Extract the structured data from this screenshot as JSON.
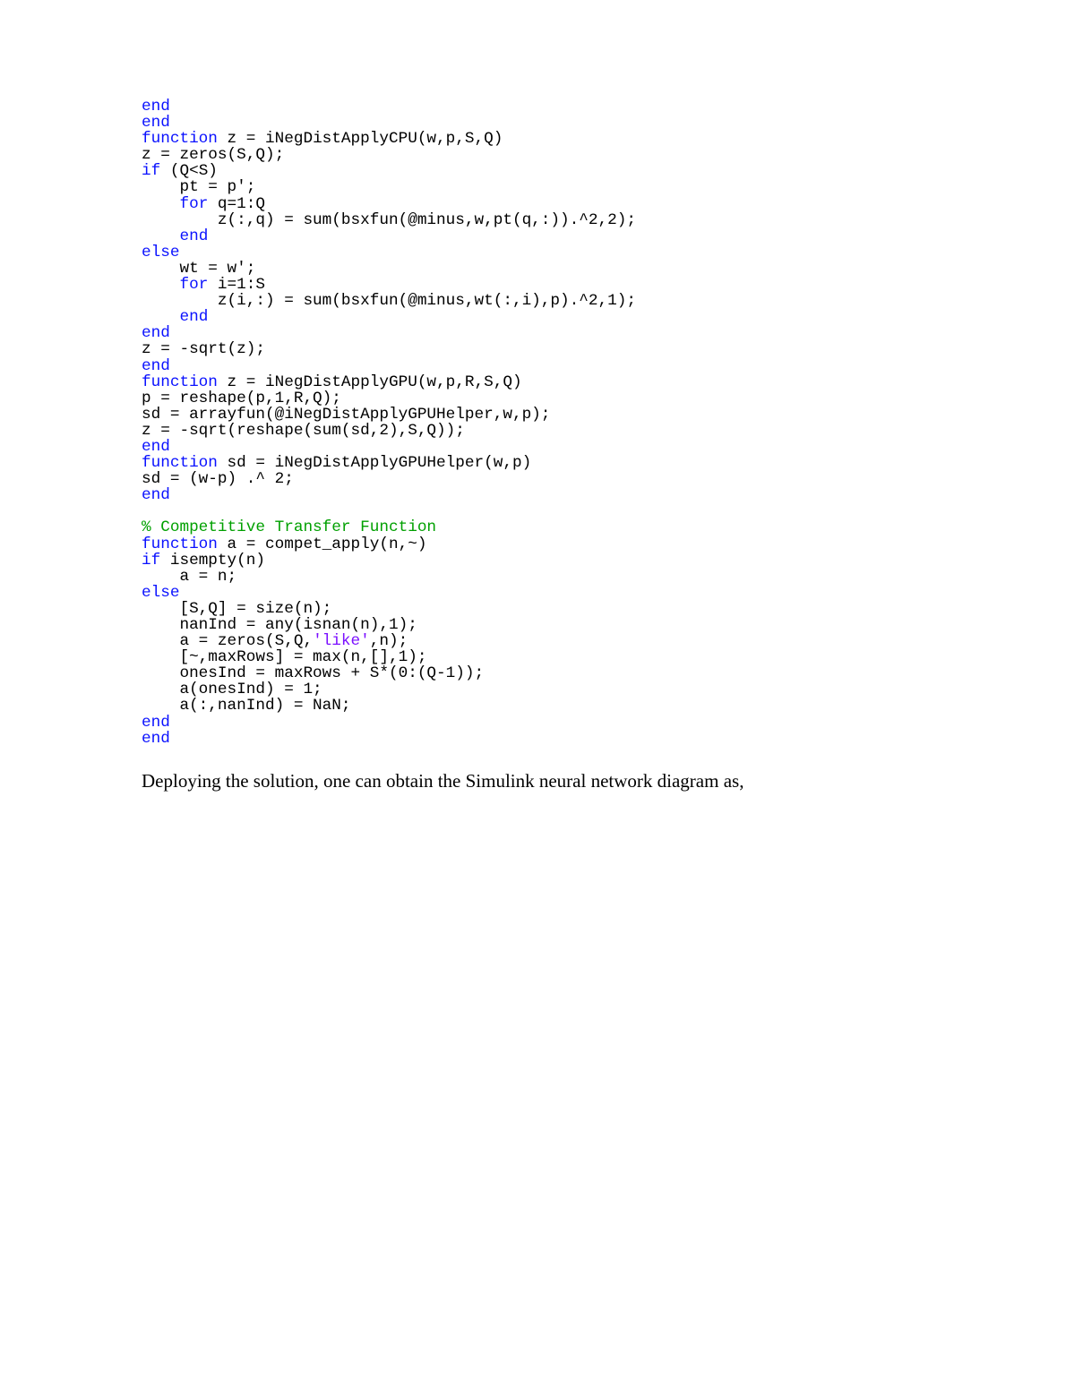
{
  "code": {
    "l01": "end",
    "l02": "end",
    "l03a": "function",
    "l03b": " z = iNegDistApplyCPU(w,p,S,Q)",
    "l04": "z = zeros(S,Q);",
    "l05a": "if",
    "l05b": " (Q<S)",
    "l06": "    pt = p';",
    "l07a": "    ",
    "l07b": "for",
    "l07c": " q=1:Q",
    "l08": "        z(:,q) = sum(bsxfun(@minus,w,pt(q,:)).^2,2);",
    "l09a": "    ",
    "l09b": "end",
    "l10": "else",
    "l11": "    wt = w';",
    "l12a": "    ",
    "l12b": "for",
    "l12c": " i=1:S",
    "l13": "        z(i,:) = sum(bsxfun(@minus,wt(:,i),p).^2,1);",
    "l14a": "    ",
    "l14b": "end",
    "l15": "end",
    "l16": "z = -sqrt(z);",
    "l17": "end",
    "l18a": "function",
    "l18b": " z = iNegDistApplyGPU(w,p,R,S,Q)",
    "l19": "p = reshape(p,1,R,Q);",
    "l20": "sd = arrayfun(@iNegDistApplyGPUHelper,w,p);",
    "l21": "z = -sqrt(reshape(sum(sd,2),S,Q));",
    "l22": "end",
    "l23a": "function",
    "l23b": " sd = iNegDistApplyGPUHelper(w,p)",
    "l24": "sd = (w-p) .^ 2;",
    "l25": "end",
    "blank1": " ",
    "l26": "% Competitive Transfer Function",
    "l27a": "function",
    "l27b": " a = compet_apply(n,~)",
    "l28a": "if",
    "l28b": " isempty(n)",
    "l29": "    a = n;",
    "l30": "else",
    "l31": "    [S,Q] = size(n);",
    "l32": "    nanInd = any(isnan(n),1);",
    "l33a": "    a = zeros(S,Q,",
    "l33b": "'like'",
    "l33c": ",n);",
    "l34": "    [~,maxRows] = max(n,[],1);",
    "l35": "    onesInd = maxRows + S*(0:(Q-1));",
    "l36": "    a(onesInd) = 1;",
    "l37": "    a(:,nanInd) = NaN;",
    "l38": "end",
    "l39": "end"
  },
  "body_text": "Deploying the solution, one can obtain the Simulink neural network diagram as,"
}
